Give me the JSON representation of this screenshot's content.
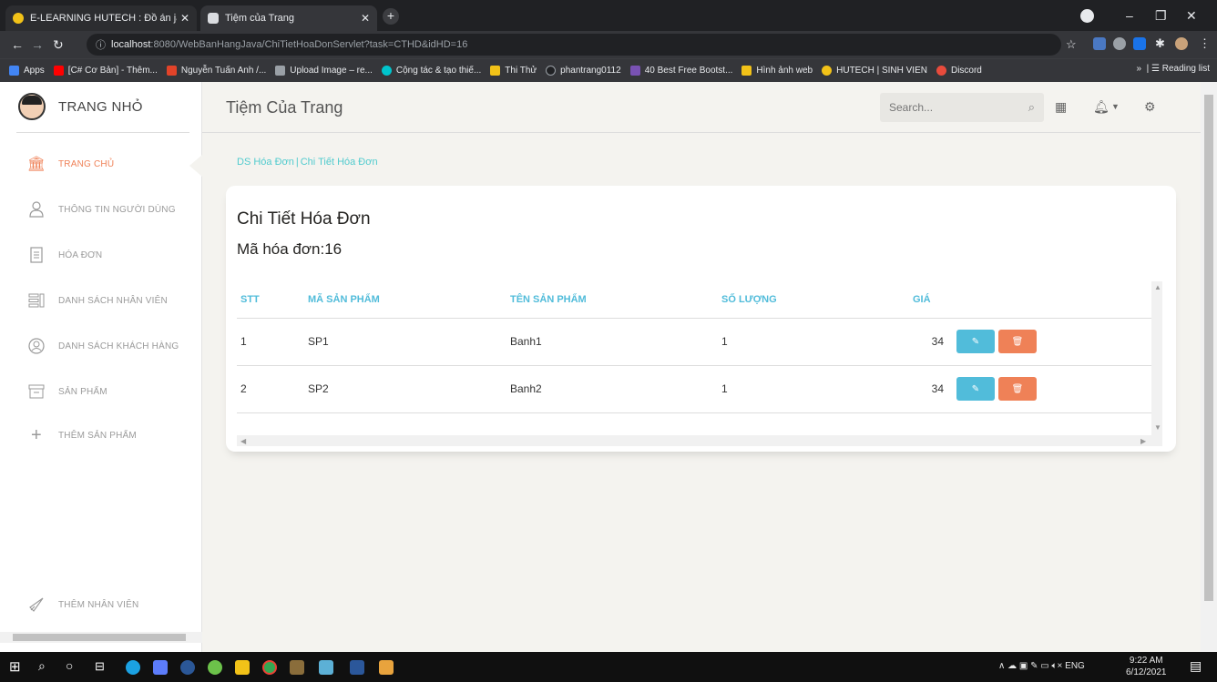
{
  "browser": {
    "tabs": [
      {
        "label": "E-LEARNING HUTECH : Đồ án java",
        "active": false
      },
      {
        "label": "Tiệm của Trang",
        "active": true
      }
    ],
    "url_host": "localhost",
    "url_rest": ":8080/WebBanHangJava/ChiTietHoaDonServlet?task=CTHD&idHD=16",
    "bookmarks": [
      "Apps",
      "[C# Cơ Bản] - Thêm...",
      "Nguyễn Tuấn Anh /...",
      "Upload Image – re...",
      "Cộng tác & tạo thiế...",
      "Thi Thử",
      "phantrang0112",
      "40 Best Free Bootst...",
      "Hình ảnh web",
      "HUTECH | SINH VIEN",
      "Discord"
    ],
    "reading_list": "Reading list"
  },
  "sidebar": {
    "brand": "TRANG NHỎ",
    "items": [
      {
        "label": "TRANG CHỦ",
        "icon": "bank-icon",
        "active": true
      },
      {
        "label": "THÔNG TIN NGƯỜI DÙNG",
        "icon": "user-icon"
      },
      {
        "label": "HÓA ĐƠN",
        "icon": "receipt-icon"
      },
      {
        "label": "DANH SÁCH NHÂN VIÊN",
        "icon": "list-icon"
      },
      {
        "label": "DANH SÁCH KHÁCH HÀNG",
        "icon": "customer-icon"
      },
      {
        "label": "SẢN PHẨM",
        "icon": "box-icon"
      },
      {
        "label": "THÊM SẢN PHẨM",
        "icon": "plus-icon"
      }
    ],
    "bottom_item": {
      "label": "THÊM NHÂN VIÊN",
      "icon": "rocket-icon"
    }
  },
  "header": {
    "title": "Tiệm Của Trang",
    "search_placeholder": "Search..."
  },
  "breadcrumb": {
    "parent": "DS Hóa Đơn",
    "current": "Chi Tiết Hóa Đơn"
  },
  "card": {
    "title": "Chi Tiết Hóa Đơn",
    "subtitle": "Mã hóa đơn:16"
  },
  "table": {
    "headers": [
      "STT",
      "MÃ SẢN PHẨM",
      "TÊN SẢN PHẨM",
      "SỐ LƯỢNG",
      "GIÁ"
    ],
    "rows": [
      {
        "stt": "1",
        "ma": "SP1",
        "ten": "Banh1",
        "so_luong": "1",
        "gia": "34"
      },
      {
        "stt": "2",
        "ma": "SP2",
        "ten": "Banh2",
        "so_luong": "1",
        "gia": "34"
      }
    ]
  },
  "taskbar": {
    "language": "ENG",
    "time": "9:22 AM",
    "date": "6/12/2021"
  },
  "colors": {
    "accent_orange": "#ef8157",
    "accent_info": "#51bcda",
    "accent_teal": "#51cbce"
  }
}
